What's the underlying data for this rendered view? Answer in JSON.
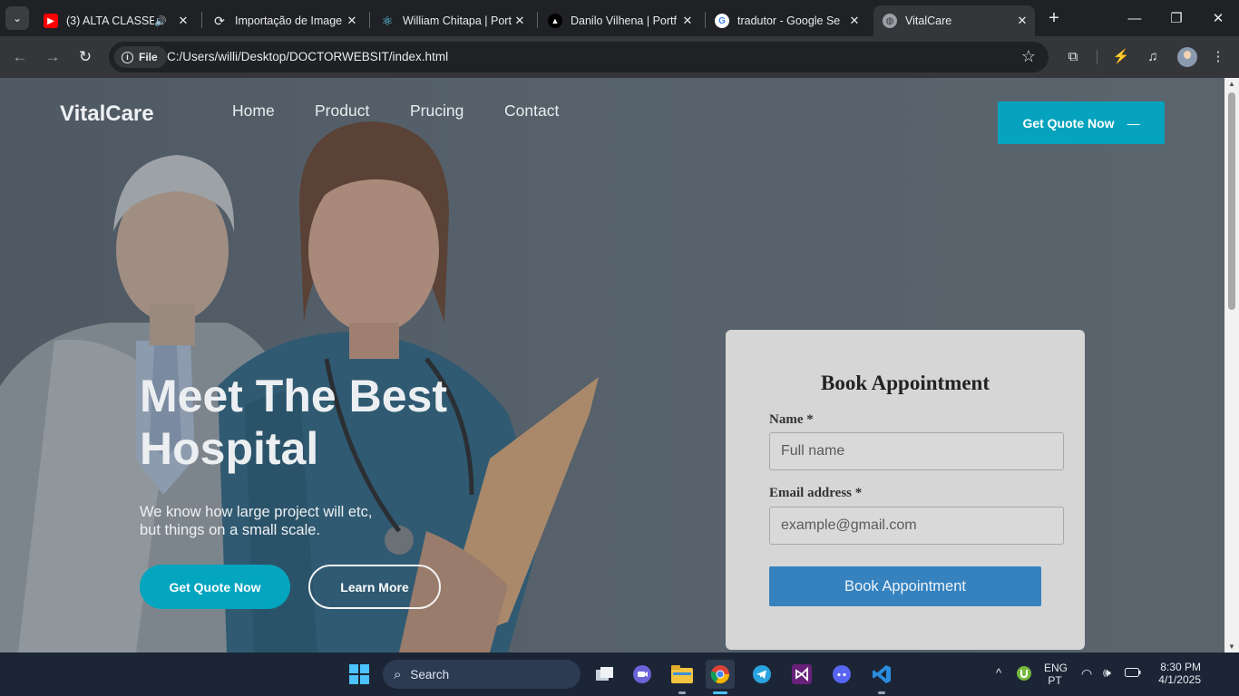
{
  "browser": {
    "tabs": [
      {
        "title": "(3) ALTA CLASSE -",
        "favicon": "youtube-icon",
        "audio": true
      },
      {
        "title": "Importação de Image",
        "favicon": "refresh-logo-icon"
      },
      {
        "title": "William Chitapa | Port",
        "favicon": "react-icon"
      },
      {
        "title": "Danilo Vilhena | Portf",
        "favicon": "triangle-icon"
      },
      {
        "title": "tradutor - Google Se",
        "favicon": "google-icon"
      },
      {
        "title": "VitalCare",
        "favicon": "globe-icon",
        "active": true
      }
    ],
    "address": {
      "scheme_label": "File",
      "url": "C:/Users/willi/Desktop/DOCTORWEBSIT/index.html"
    }
  },
  "site": {
    "logo": "VitalCare",
    "nav": [
      "Home",
      "Product",
      "Prucing",
      "Contact"
    ],
    "top_cta": "Get Quote Now",
    "hero": {
      "title_line1": "Meet The Best",
      "title_line2": "Hospital",
      "subtitle_line1": "We know how large project will etc,",
      "subtitle_line2": "but things on a small scale.",
      "primary_cta": "Get Quote Now",
      "secondary_cta": "Learn More"
    },
    "appointment": {
      "title": "Book Appointment",
      "name_label": "Name *",
      "name_placeholder": "Full name",
      "email_label": "Email address *",
      "email_placeholder": "example@gmail.com",
      "submit": "Book Appointment"
    },
    "colors": {
      "accent": "#05a3bd",
      "submit": "#3582bf",
      "card": "#d6d6d6"
    }
  },
  "taskbar": {
    "search_label": "Search",
    "lang_top": "ENG",
    "lang_bottom": "PT",
    "time": "8:30 PM",
    "date": "4/1/2025"
  }
}
